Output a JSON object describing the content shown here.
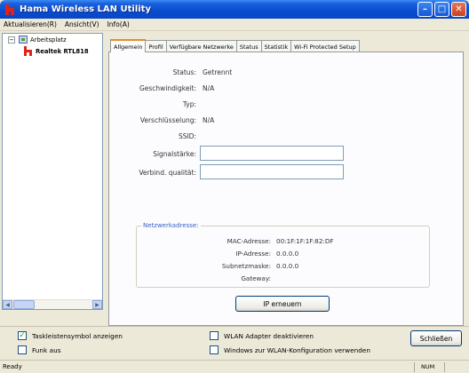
{
  "window": {
    "title": "Hama Wireless LAN Utility"
  },
  "menu": [
    "Aktualisieren(R)",
    "Ansicht(V)",
    "Info(A)"
  ],
  "tree": {
    "root_label": "Arbeitsplatz",
    "child_label": "Realtek RTL818"
  },
  "tabs": [
    "Allgemein",
    "Profil",
    "Verfügbare Netzwerke",
    "Status",
    "Statistik",
    "Wi-Fi Protected Setup"
  ],
  "general": {
    "status_label": "Status:",
    "status_value": "Getrennt",
    "speed_label": "Geschwindigkeit:",
    "speed_value": "N/A",
    "type_label": "Typ:",
    "type_value": "",
    "encryption_label": "Verschlüsselung:",
    "encryption_value": "N/A",
    "ssid_label": "SSID:",
    "ssid_value": "",
    "signal_label": "Signalstärke:",
    "quality_label": "Verbind. qualität:"
  },
  "network": {
    "legend": "Netzwerkadresse:",
    "mac_label": "MAC-Adresse:",
    "mac_value": "00:1F:1F:1F:82:DF",
    "ip_label": "IP-Adresse:",
    "ip_value": "0.0.0.0",
    "subnet_label": "Subnetzmaske:",
    "subnet_value": "0.0.0.0",
    "gateway_label": "Gateway:",
    "gateway_value": ""
  },
  "buttons": {
    "renew_ip": "IP erneuern",
    "close": "Schließen"
  },
  "options": {
    "tray_icon": {
      "label": "Taskleistensymbol anzeigen",
      "checked": true
    },
    "radio_off": {
      "label": "Funk aus",
      "checked": false
    },
    "disable_adapter": {
      "label": "WLAN Adapter deaktivieren",
      "checked": false
    },
    "use_windows": {
      "label": "Windows zur WLAN-Konfiguration verwenden",
      "checked": false
    }
  },
  "statusbar": {
    "text": "Ready",
    "num": "NUM"
  },
  "colors": {
    "titlebar": "#0a4cd0",
    "accent_red": "#e02318",
    "legend_blue": "#3a5ec8"
  }
}
